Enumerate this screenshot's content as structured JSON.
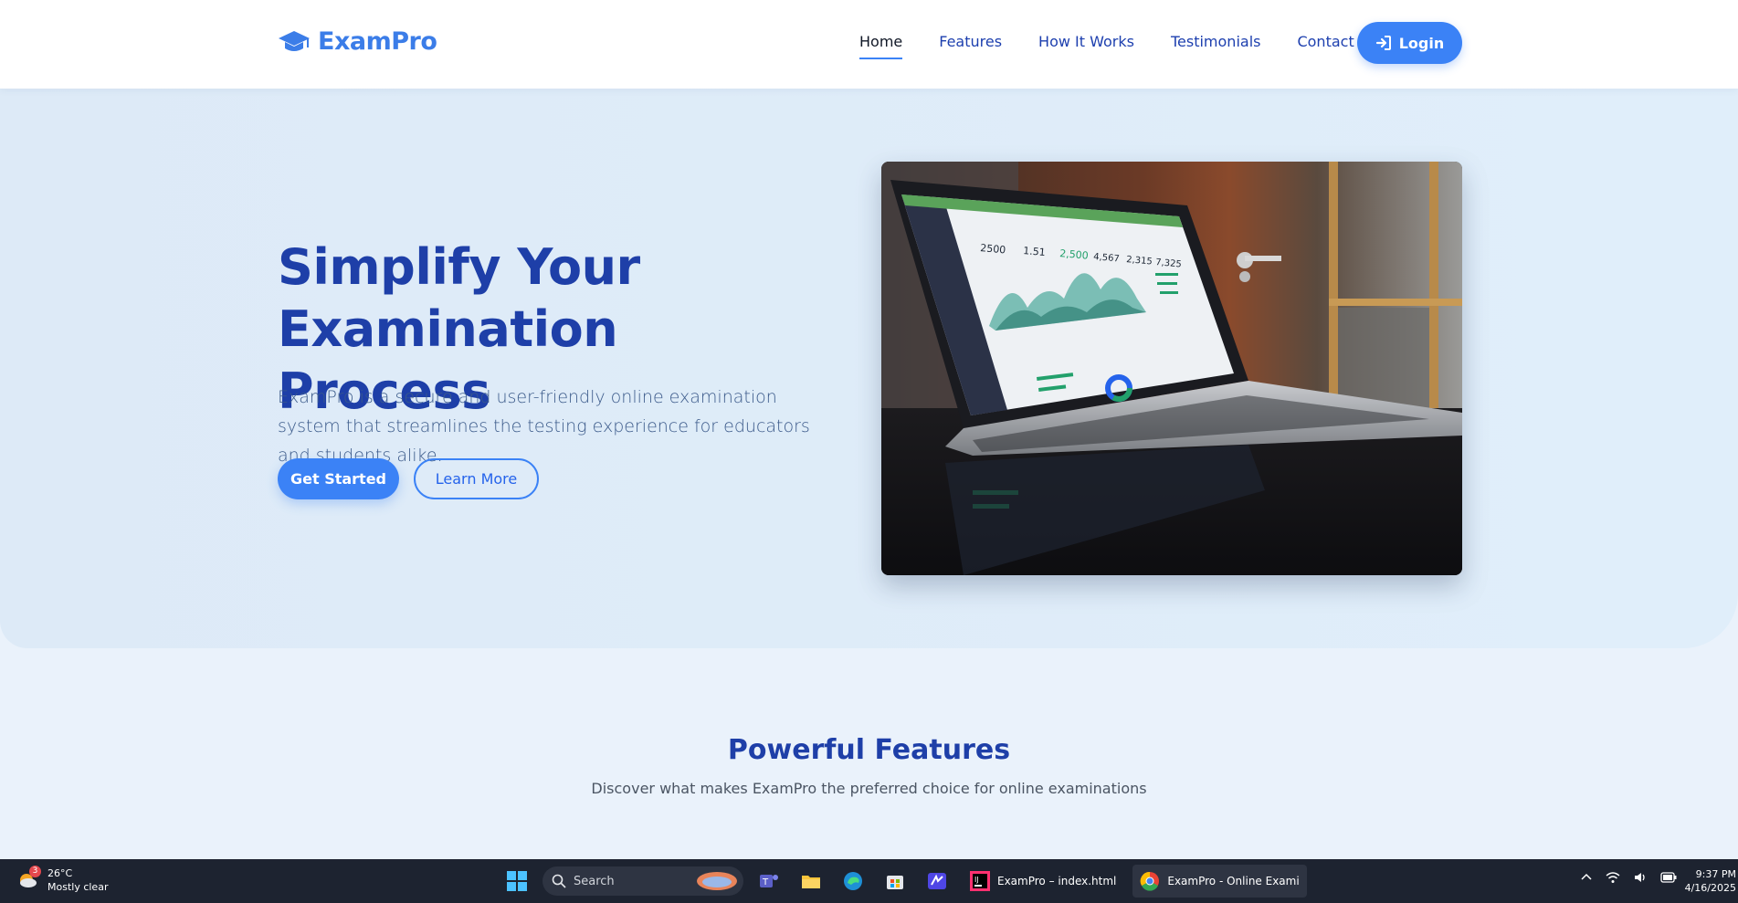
{
  "brand": {
    "name": "ExamPro",
    "icon": "graduation-cap-icon"
  },
  "nav": {
    "links": [
      {
        "label": "Home",
        "active": true
      },
      {
        "label": "Features",
        "active": false
      },
      {
        "label": "How It Works",
        "active": false
      },
      {
        "label": "Testimonials",
        "active": false
      },
      {
        "label": "Contact",
        "active": false
      }
    ],
    "login_label": "Login"
  },
  "hero": {
    "title_line1": "Simplify Your",
    "title_line2": "Examination Process",
    "description": "ExamPro is a secure and user-friendly online examination system that streamlines the testing experience for educators and students alike.",
    "primary_button": "Get Started",
    "secondary_button": "Learn More"
  },
  "dashboard_image": {
    "kpis": [
      "2500",
      "1.51",
      "2,500",
      "4,567",
      "2,315",
      "7,325"
    ]
  },
  "features": {
    "title": "Powerful Features",
    "subtitle": "Discover what makes ExamPro the preferred choice for online examinations"
  },
  "taskbar": {
    "weather_temp": "26°C",
    "weather_desc": "Mostly clear",
    "weather_badge": "3",
    "search_placeholder": "Search",
    "apps": [
      {
        "label": "ExamPro – index.html",
        "icon": "intellij-icon"
      },
      {
        "label": "ExamPro - Online Exami",
        "icon": "chrome-icon"
      }
    ],
    "time": "9:37 PM",
    "date": "4/16/2025"
  },
  "colors": {
    "accent": "#3b82f6",
    "heading": "#1e3fa8",
    "hero_bg": "#ddeaf7"
  }
}
